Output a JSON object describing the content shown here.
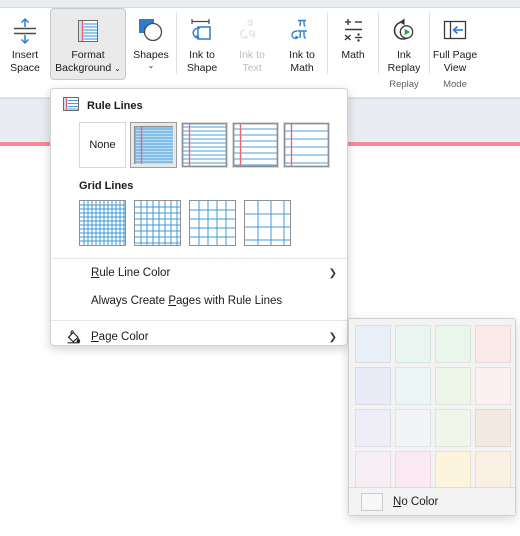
{
  "ribbon": {
    "groups": [
      {
        "label": "",
        "buttons": [
          {
            "name": "insert-space",
            "label": "Insert\nSpace",
            "icon": "insert-space-icon",
            "selected": false,
            "disabled": false,
            "wide": false
          },
          {
            "name": "format-background",
            "label": "Format\nBackground",
            "icon": "format-background-icon",
            "selected": true,
            "disabled": false,
            "wide": true,
            "chevron": "⌄"
          },
          {
            "name": "shapes",
            "label": "Shapes",
            "icon": "shapes-icon",
            "selected": false,
            "disabled": false,
            "wide": false,
            "chevron": "⌄"
          }
        ]
      },
      {
        "label": "",
        "buttons": [
          {
            "name": "ink-to-shape",
            "label": "Ink to\nShape",
            "icon": "ink-to-shape-icon",
            "selected": false,
            "disabled": false,
            "wide": false
          },
          {
            "name": "ink-to-text",
            "label": "Ink to\nText",
            "icon": "ink-to-text-icon",
            "selected": false,
            "disabled": true,
            "wide": false
          },
          {
            "name": "ink-to-math",
            "label": "Ink to\nMath",
            "icon": "ink-to-math-icon",
            "selected": false,
            "disabled": false,
            "wide": false
          }
        ]
      },
      {
        "label": "",
        "buttons": [
          {
            "name": "math",
            "label": "Math",
            "icon": "math-icon",
            "selected": false,
            "disabled": false,
            "wide": false
          }
        ]
      },
      {
        "label": "Replay",
        "buttons": [
          {
            "name": "ink-replay",
            "label": "Ink\nReplay",
            "icon": "ink-replay-icon",
            "selected": false,
            "disabled": false,
            "wide": false
          }
        ]
      },
      {
        "label": "Mode",
        "buttons": [
          {
            "name": "full-page-view",
            "label": "Full Page\nView",
            "icon": "full-page-view-icon",
            "selected": false,
            "disabled": false,
            "wide": false
          }
        ]
      }
    ]
  },
  "menu": {
    "rule_lines": {
      "title": "Rule Lines",
      "icon": "rule-lines-icon",
      "options": [
        {
          "name": "rule-lines-none",
          "label": "None",
          "selected": false,
          "spacing": 0
        },
        {
          "name": "rule-lines-narrow",
          "label": "",
          "selected": true,
          "spacing": 3
        },
        {
          "name": "rule-lines-college",
          "label": "",
          "selected": false,
          "spacing": 4
        },
        {
          "name": "rule-lines-standard",
          "label": "",
          "selected": false,
          "spacing": 6
        },
        {
          "name": "rule-lines-wide",
          "label": "",
          "selected": false,
          "spacing": 8
        }
      ]
    },
    "grid_lines": {
      "title": "Grid Lines",
      "options": [
        {
          "name": "grid-lines-small",
          "spacing": 4
        },
        {
          "name": "grid-lines-medium",
          "spacing": 6
        },
        {
          "name": "grid-lines-large",
          "spacing": 9
        },
        {
          "name": "grid-lines-very-large",
          "spacing": 13
        }
      ]
    },
    "items": [
      {
        "name": "rule-line-color",
        "label": "Rule Line Color",
        "accel": "R",
        "submenu": true,
        "icon": ""
      },
      {
        "name": "always-create-pages-with-rule-lines",
        "label": "Always Create Pages with Rule Lines",
        "accel": "P",
        "accel_index": 20,
        "submenu": false,
        "icon": ""
      },
      {
        "name": "page-color",
        "label": "Page Color",
        "accel": "P",
        "submenu": true,
        "icon": "paint-bucket-icon"
      }
    ],
    "arrow_glyph": "❯"
  },
  "color_flyout": {
    "swatches": [
      {
        "name": "swatch-blue-light",
        "color": "#e9eff7"
      },
      {
        "name": "swatch-cyan-light",
        "color": "#e9f5f1"
      },
      {
        "name": "swatch-green-light",
        "color": "#eaf6ec"
      },
      {
        "name": "swatch-red-light",
        "color": "#fbeaea"
      },
      {
        "name": "swatch-blue-lighter",
        "color": "#e9ecf6"
      },
      {
        "name": "swatch-cyan-lighter",
        "color": "#edf6f6"
      },
      {
        "name": "swatch-green-lighter",
        "color": "#edf6e9"
      },
      {
        "name": "swatch-red-lighter",
        "color": "#fbf0f2"
      },
      {
        "name": "swatch-violet-lighter",
        "color": "#efedf6"
      },
      {
        "name": "swatch-gray-lighter",
        "color": "#f2f4f5"
      },
      {
        "name": "swatch-lime-lighter",
        "color": "#f0f6e9"
      },
      {
        "name": "swatch-tan",
        "color": "#f2e9e1"
      },
      {
        "name": "swatch-lavender",
        "color": "#f6eff6"
      },
      {
        "name": "swatch-pink",
        "color": "#fbeaf3"
      },
      {
        "name": "swatch-yellow",
        "color": "#fdf4dd"
      },
      {
        "name": "swatch-peach",
        "color": "#fbf0e4"
      }
    ],
    "no_color": {
      "name": "no-color",
      "label": "No Color",
      "accel": "N"
    }
  }
}
